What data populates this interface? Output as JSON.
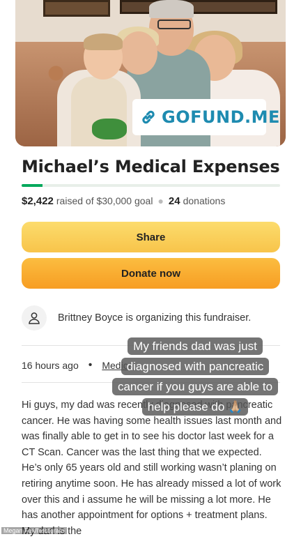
{
  "hero": {
    "badge_text": "GOFUND.ME",
    "badge_icon": "link-icon",
    "badge_color": "#1e8bb0"
  },
  "fundraiser": {
    "title": "Michael’s Medical Expenses",
    "raised": "$2,422",
    "goal_text": "raised of $30,000 goal",
    "donations_count": "24",
    "donations_label": "donations",
    "progress_fraction": 0.081,
    "accent_color": "#02a95c"
  },
  "actions": {
    "share_label": "Share",
    "donate_label": "Donate now"
  },
  "organizer": {
    "text": "Brittney Boyce is organizing this fundraiser."
  },
  "meta": {
    "time_ago": "16 hours ago",
    "separator": "•",
    "category": "Medical"
  },
  "story": {
    "text": "Hi guys, my dad was recently diagnosed with pancreatic cancer. He was having some health issues last month and was finally able to get in to see his doctor last week for a CT Scan. Cancer was the last thing that we expected. He’s only 65 years old and still working wasn’t planing on retiring anytime soon. He has already missed a lot of work over this and i assume he will be missing a lot more. He has another appointment for options + treatment plans. My dad is the"
  },
  "overlay_caption": {
    "lines": [
      "My friends dad was just",
      "diagnosed with pancreatic",
      "cancer if you guys are able to",
      "help please do 🙏🏼"
    ]
  },
  "watermark": "Megan Fox/Instagram"
}
